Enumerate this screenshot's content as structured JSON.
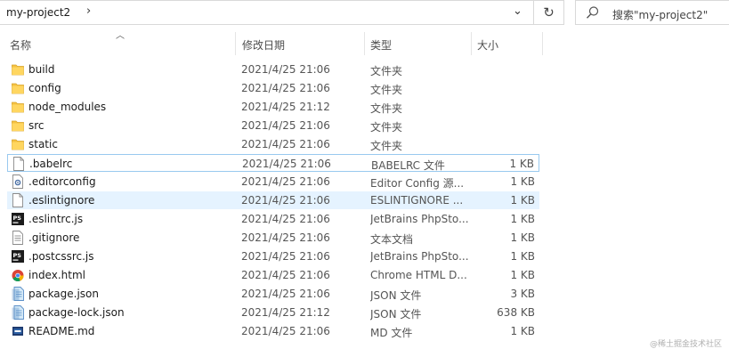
{
  "address_bar": {
    "crumb": "my-project2",
    "separator": "›",
    "dropdown": "⌄"
  },
  "refresh_glyph": "↻",
  "search": {
    "placeholder": "搜索\"my-project2\""
  },
  "columns": {
    "name": "名称",
    "date": "修改日期",
    "type": "类型",
    "size": "大小"
  },
  "files": [
    {
      "icon": "folder-icon",
      "name": "build",
      "date": "2021/4/25 21:06",
      "type": "文件夹",
      "size": ""
    },
    {
      "icon": "folder-icon",
      "name": "config",
      "date": "2021/4/25 21:06",
      "type": "文件夹",
      "size": ""
    },
    {
      "icon": "folder-icon",
      "name": "node_modules",
      "date": "2021/4/25 21:12",
      "type": "文件夹",
      "size": ""
    },
    {
      "icon": "folder-icon",
      "name": "src",
      "date": "2021/4/25 21:06",
      "type": "文件夹",
      "size": ""
    },
    {
      "icon": "folder-icon",
      "name": "static",
      "date": "2021/4/25 21:06",
      "type": "文件夹",
      "size": ""
    },
    {
      "icon": "blank-file-icon",
      "name": ".babelrc",
      "date": "2021/4/25 21:06",
      "type": "BABELRC 文件",
      "size": "1 KB"
    },
    {
      "icon": "config-file-icon",
      "name": ".editorconfig",
      "date": "2021/4/25 21:06",
      "type": "Editor Config 源...",
      "size": "1 KB"
    },
    {
      "icon": "blank-file-icon",
      "name": ".eslintignore",
      "date": "2021/4/25 21:06",
      "type": "ESLINTIGNORE ...",
      "size": "1 KB"
    },
    {
      "icon": "phpstorm-icon",
      "name": ".eslintrc.js",
      "date": "2021/4/25 21:06",
      "type": "JetBrains PhpSto...",
      "size": "1 KB"
    },
    {
      "icon": "text-file-icon",
      "name": ".gitignore",
      "date": "2021/4/25 21:06",
      "type": "文本文档",
      "size": "1 KB"
    },
    {
      "icon": "phpstorm-icon",
      "name": ".postcssrc.js",
      "date": "2021/4/25 21:06",
      "type": "JetBrains PhpSto...",
      "size": "1 KB"
    },
    {
      "icon": "chrome-icon",
      "name": "index.html",
      "date": "2021/4/25 21:06",
      "type": "Chrome HTML D...",
      "size": "1 KB"
    },
    {
      "icon": "json-file-icon",
      "name": "package.json",
      "date": "2021/4/25 21:06",
      "type": "JSON 文件",
      "size": "3 KB"
    },
    {
      "icon": "json-file-icon",
      "name": "package-lock.json",
      "date": "2021/4/25 21:12",
      "type": "JSON 文件",
      "size": "638 KB"
    },
    {
      "icon": "md-file-icon",
      "name": "README.md",
      "date": "2021/4/25 21:06",
      "type": "MD 文件",
      "size": "1 KB"
    }
  ],
  "watermark": "@稀土掘金技术社区"
}
